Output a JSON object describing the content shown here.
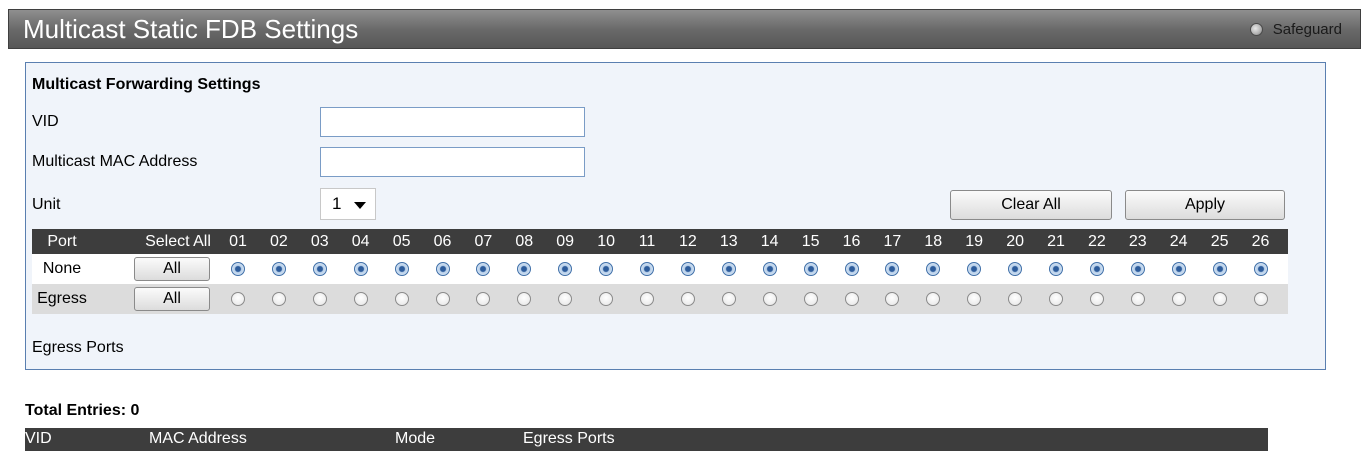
{
  "page": {
    "title": "Multicast Static FDB Settings",
    "safeguard_label": "Safeguard"
  },
  "form": {
    "section_title": "Multicast Forwarding Settings",
    "vid_label": "VID",
    "vid_value": "",
    "mac_label": "Multicast MAC Address",
    "mac_value": "",
    "unit_label": "Unit",
    "unit_value": "1",
    "clear_all_label": "Clear All",
    "apply_label": "Apply",
    "egress_ports_label": "Egress Ports"
  },
  "port_table": {
    "header_port": "Port",
    "header_select_all": "Select All",
    "ports": [
      "01",
      "02",
      "03",
      "04",
      "05",
      "06",
      "07",
      "08",
      "09",
      "10",
      "11",
      "12",
      "13",
      "14",
      "15",
      "16",
      "17",
      "18",
      "19",
      "20",
      "21",
      "22",
      "23",
      "24",
      "25",
      "26"
    ],
    "rows": [
      {
        "label": "None",
        "all_button": "All",
        "checked": true
      },
      {
        "label": "Egress",
        "all_button": "All",
        "checked": false
      }
    ]
  },
  "results": {
    "total_entries": "Total Entries: 0",
    "columns": [
      "VID",
      "MAC Address",
      "Mode",
      "Egress Ports"
    ]
  },
  "colors": {
    "title_bar": "#6a6a6a",
    "panel_border": "#5a7fb0",
    "table_header": "#3d3d3d",
    "radio_checked": "#2d5c9c"
  }
}
